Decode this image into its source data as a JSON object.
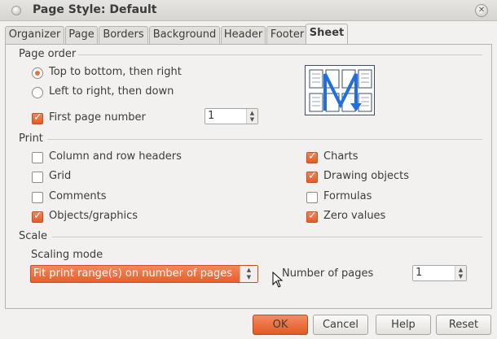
{
  "window": {
    "title": "Page Style: Default",
    "close_glyph": "✕"
  },
  "tabs": [
    {
      "label": "Organizer"
    },
    {
      "label": "Page"
    },
    {
      "label": "Borders"
    },
    {
      "label": "Background"
    },
    {
      "label": "Header"
    },
    {
      "label": "Footer"
    },
    {
      "label": "Sheet",
      "active": true
    }
  ],
  "page_order": {
    "heading": "Page order",
    "options": [
      {
        "label": "Top to bottom, then right",
        "selected": true
      },
      {
        "label": "Left to right, then down",
        "selected": false
      }
    ],
    "first_page_number": {
      "label": "First page number",
      "checked": true,
      "value": "1"
    }
  },
  "print": {
    "heading": "Print",
    "items": [
      {
        "label": "Column and row headers",
        "checked": false
      },
      {
        "label": "Grid",
        "checked": false
      },
      {
        "label": "Comments",
        "checked": false
      },
      {
        "label": "Objects/graphics",
        "checked": true
      },
      {
        "label": "Charts",
        "checked": true
      },
      {
        "label": "Drawing objects",
        "checked": true
      },
      {
        "label": "Formulas",
        "checked": false
      },
      {
        "label": "Zero values",
        "checked": true
      }
    ]
  },
  "scale": {
    "heading": "Scale",
    "mode_label": "Scaling mode",
    "mode_value": "Fit print range(s) on number of pages",
    "pages_label": "Number of pages",
    "pages_value": "1"
  },
  "buttons": {
    "ok": "OK",
    "cancel": "Cancel",
    "help": "Help",
    "reset": "Reset"
  },
  "colors": {
    "accent": "#ef6f3c",
    "preview_arrow": "#1f6fe0"
  }
}
